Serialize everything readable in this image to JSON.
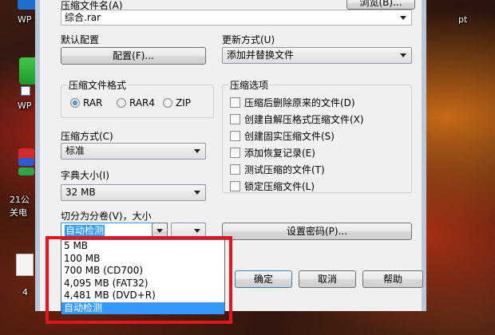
{
  "desktop": {
    "icon1_label": "WP",
    "icon2_label": "WP",
    "icon3_label": "21公",
    "icon3_label2": "关电",
    "icon4_label": "4",
    "right_label": "pt"
  },
  "archive_name": {
    "label": "压缩文件名(A)",
    "value": "综合.rar",
    "browse_label": "浏览(B)..."
  },
  "profile": {
    "label": "默认配置",
    "button": "配置(F)..."
  },
  "update_mode": {
    "label": "更新方式(U)",
    "value": "添加并替换文件"
  },
  "format": {
    "title": "压缩文件格式",
    "options": [
      "RAR",
      "RAR4",
      "ZIP"
    ],
    "selected": "RAR"
  },
  "method": {
    "label": "压缩方式(C)",
    "value": "标准"
  },
  "dictionary": {
    "label": "字典大小(I)",
    "value": "32 MB"
  },
  "split": {
    "label": "切分为分卷(V)，大小",
    "value": "自动检测",
    "options": [
      "5 MB",
      "100 MB",
      "700 MB  (CD700)",
      "4,095 MB  (FAT32)",
      "4,481 MB  (DVD+R)",
      "自动检测"
    ],
    "selected_index": 5
  },
  "options": {
    "title": "压缩选项",
    "items": [
      "压缩后删除原来的文件(D)",
      "创建自解压格式压缩文件(X)",
      "创建固实压缩文件(S)",
      "添加恢复记录(E)",
      "测试压缩的文件(T)",
      "锁定压缩文件(L)"
    ]
  },
  "password_button": "设置密码(P)...",
  "buttons": {
    "ok": "确定",
    "cancel": "取消",
    "help": "帮助"
  },
  "colors": {
    "highlight": "#3399ff",
    "annotation_red": "#e8141c"
  }
}
